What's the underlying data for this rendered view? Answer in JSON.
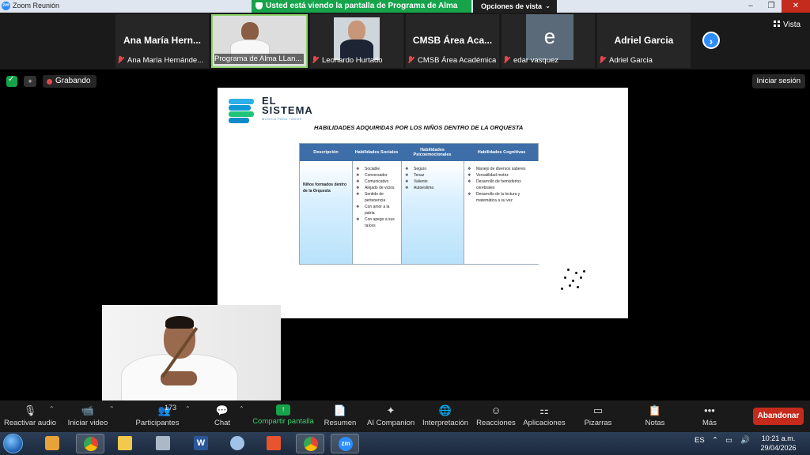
{
  "window": {
    "title": "Zoom Reunión",
    "logo_text": "zm",
    "controls": [
      "–",
      "❐",
      "✕"
    ]
  },
  "share_banner": {
    "text": "Usted está viendo la pantalla de Programa de Alma LLanera",
    "view_options": "Opciones de vista"
  },
  "participants": [
    {
      "big_name": "Ana María Hern...",
      "label": "Ana María Hernánde..."
    },
    {
      "big_name": "",
      "label": "Programa de Alma LLan..."
    },
    {
      "big_name": "",
      "label": "Leonardo Hurtado"
    },
    {
      "big_name": "CMSB Área Aca...",
      "label": "CMSB Área Académica"
    },
    {
      "big_name": "",
      "avatar_letter": "e",
      "label": "edar vasquez"
    },
    {
      "big_name": "Adriel Garcia",
      "label": "Adriel Garcia"
    }
  ],
  "view_label": "Vista",
  "status": {
    "recording": "Grabando",
    "sign_in": "Iniciar sesión",
    "ai_badge": "✦"
  },
  "slide": {
    "logo_line1": "EL",
    "logo_line2": "SISTEMA",
    "logo_sub": "MÚSICA PARA TODOS",
    "title": "HABILIDADES ADQUIRIDAS POR LOS NIÑOS DENTRO DE LA ORQUESTA",
    "headers": [
      "Descripción",
      "Habilidades Sociales",
      "Habilidades Psicoemocionales",
      "Habilidades Cognitivas"
    ],
    "description": "Niños formados dentro de la Orquesta",
    "social": [
      "Sociable",
      "Conversador",
      "Comunicativo",
      "Alejado de vicios",
      "Sentido de pertenencia",
      "Con amor a la patria",
      "Con apego a sus raíces"
    ],
    "psychoemotional": [
      "Seguro",
      "Tenaz",
      "Valiente",
      "Autoestima"
    ],
    "cognitive": [
      "Manejo de diversos saberes",
      "Versatilidad motriz",
      "Desarrollo de hemisferios cerebrales",
      "Desarrollo de la lectura y matemática a su vez"
    ]
  },
  "toolbar": {
    "items": [
      {
        "label": "Reactivar audio",
        "icon": "🎙"
      },
      {
        "label": "Iniciar video",
        "icon": "📹"
      },
      {
        "label": "Participantes",
        "icon": "👥",
        "count": "173"
      },
      {
        "label": "Chat",
        "icon": "💬"
      },
      {
        "label": "Compartir pantalla",
        "icon": "↑"
      },
      {
        "label": "Resumen",
        "icon": "📄"
      },
      {
        "label": "AI Companion",
        "icon": "✦"
      },
      {
        "label": "Interpretación",
        "icon": "🌐"
      },
      {
        "label": "Reacciones",
        "icon": "☺"
      },
      {
        "label": "Aplicaciones",
        "icon": "⚏"
      },
      {
        "label": "Pizarras",
        "icon": "▭"
      },
      {
        "label": "Notas",
        "icon": "📋"
      },
      {
        "label": "Más",
        "icon": "•••"
      }
    ],
    "leave": "Abandonar"
  },
  "taskbar": {
    "language": "ES",
    "time": "10:21 a.m.",
    "date": "29/04/2026",
    "zoom_label": "zm"
  }
}
